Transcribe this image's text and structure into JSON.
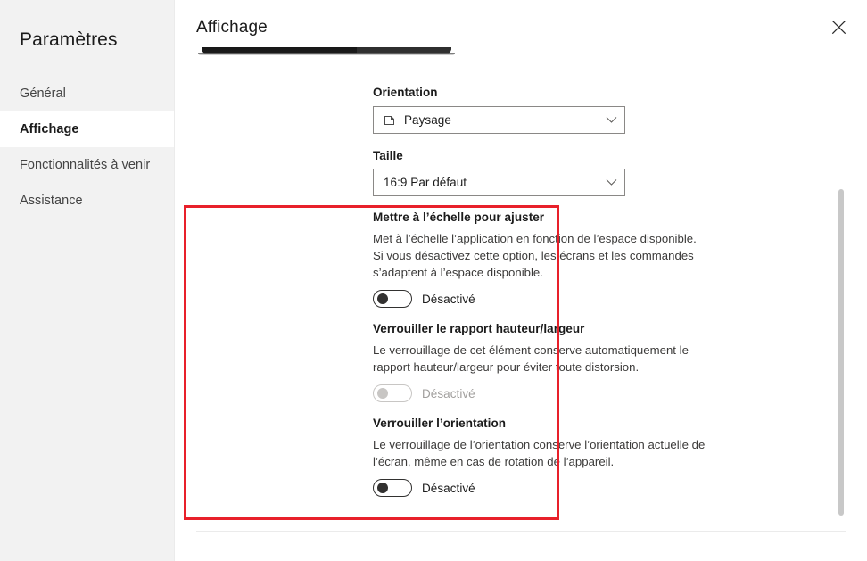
{
  "sidebar": {
    "title": "Paramètres",
    "items": [
      {
        "label": "Général",
        "selected": false
      },
      {
        "label": "Affichage",
        "selected": true
      },
      {
        "label": "Fonctionnalités à venir",
        "selected": false
      },
      {
        "label": "Assistance",
        "selected": false
      }
    ]
  },
  "panel": {
    "title": "Affichage",
    "close_icon": "close-icon"
  },
  "fields": {
    "orientation": {
      "label": "Orientation",
      "value": "Paysage",
      "icon": "page-landscape-icon",
      "chevron": "chevron-down-icon"
    },
    "taille": {
      "label": "Taille",
      "value": "16:9 Par défaut",
      "chevron": "chevron-down-icon"
    }
  },
  "settings": [
    {
      "title": "Mettre à l’échelle pour ajuster",
      "description": "Met à l’échelle l’application en fonction de l’espace disponible. Si vous désactivez cette option, les écrans et les commandes s’adaptent à l’espace disponible.",
      "toggle_label": "Désactivé",
      "toggle_on": false,
      "toggle_disabled": false
    },
    {
      "title": "Verrouiller le rapport hauteur/largeur",
      "description": "Le verrouillage de cet élément conserve automatiquement le rapport hauteur/largeur pour éviter toute distorsion.",
      "toggle_label": "Désactivé",
      "toggle_on": false,
      "toggle_disabled": true
    },
    {
      "title": "Verrouiller l’orientation",
      "description": "Le verrouillage de l’orientation conserve l’orientation actuelle de l’écran, même en cas de rotation de l’appareil.",
      "toggle_label": "Désactivé",
      "toggle_on": false,
      "toggle_disabled": false
    }
  ],
  "annotation": {
    "color": "#e8202a"
  },
  "colors": {
    "sidebar_background": "#f2f2f2",
    "panel_background": "#ffffff",
    "text_primary": "#1b1b1b",
    "text_secondary": "#3b3a39",
    "text_disabled": "#a19f9d",
    "border": "#8a8886",
    "scrollbar_thumb": "#c8c8c8"
  }
}
